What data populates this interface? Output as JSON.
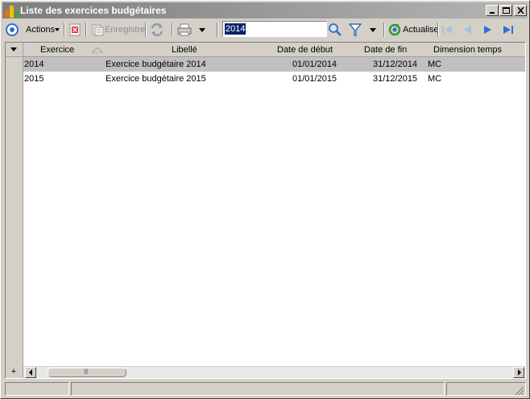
{
  "window": {
    "title": "Liste des exercices budgétaires"
  },
  "toolbar": {
    "actions_label": "Actions",
    "save_label": "Enregistre",
    "search_value": "2014",
    "refresh_label": "Actualise"
  },
  "grid": {
    "columns": [
      "Exercice",
      "Libellé",
      "Date de début",
      "Date de fin",
      "Dimension temps"
    ],
    "rows": [
      {
        "exercice": "2014",
        "libelle": "Exercice budgétaire 2014",
        "debut": "01/01/2014",
        "fin": "31/12/2014",
        "dimension": "MC"
      },
      {
        "exercice": "2015",
        "libelle": "Exercice budgétaire 2015",
        "debut": "01/01/2015",
        "fin": "31/12/2015",
        "dimension": "MC"
      }
    ],
    "add_symbol": "+",
    "thumb_grip": "III"
  },
  "colors": {
    "selected_row": "#c0c0c0",
    "title_gradient_start": "#7d7d7d",
    "nav_blue": "#2f6fd6"
  }
}
